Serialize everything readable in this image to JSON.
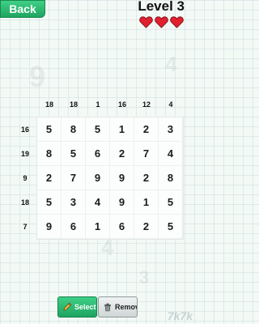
{
  "header": {
    "back_label": "Back",
    "level_label": "Level 3",
    "lives": 3,
    "heart_color": "#e0202e"
  },
  "puzzle": {
    "column_clues": [
      "18",
      "18",
      "1",
      "16",
      "12",
      "4"
    ],
    "row_clues": [
      "16",
      "19",
      "9",
      "18",
      "7"
    ],
    "rows": [
      [
        "5",
        "8",
        "5",
        "1",
        "2",
        "3"
      ],
      [
        "8",
        "5",
        "6",
        "2",
        "7",
        "4"
      ],
      [
        "2",
        "7",
        "9",
        "9",
        "2",
        "8"
      ],
      [
        "5",
        "3",
        "4",
        "9",
        "1",
        "5"
      ],
      [
        "9",
        "6",
        "1",
        "6",
        "2",
        "5"
      ]
    ]
  },
  "toolbar": {
    "select_label": "Select",
    "remove_label": "Remove",
    "select_icon": "pencil-icon",
    "remove_icon": "trash-icon"
  },
  "colors": {
    "accent_green": "#28b86f",
    "background": "#f3f9f5"
  }
}
